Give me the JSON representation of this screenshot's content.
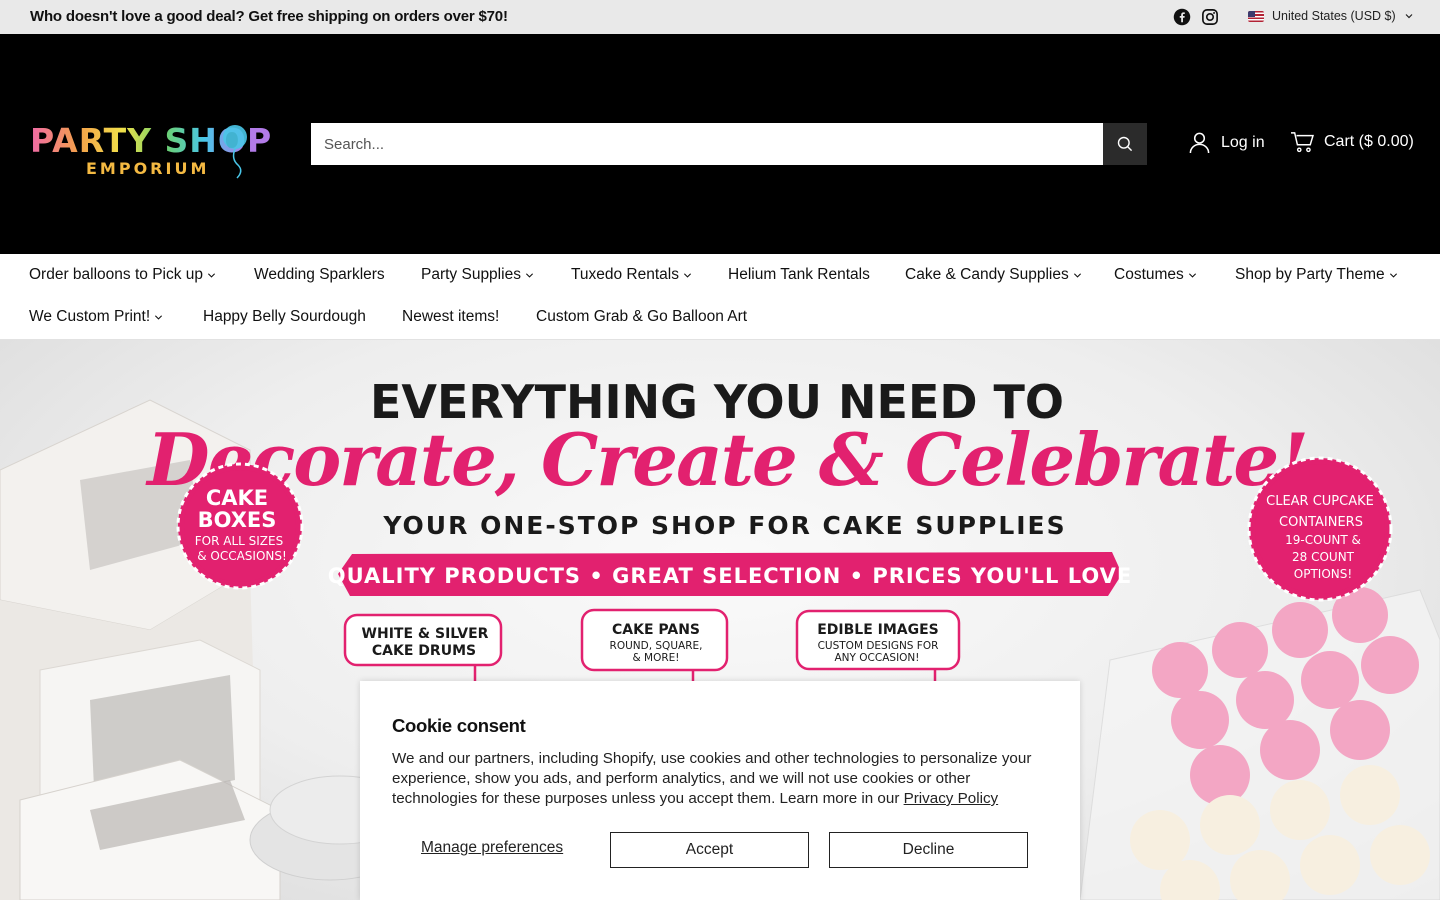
{
  "announcement": {
    "text": "Who doesn't love a good deal? Get free shipping on orders over $70!",
    "currency": "United States (USD $)"
  },
  "header": {
    "logo_top": "PARTY SHOP",
    "logo_bottom": "EMPORIUM",
    "search_placeholder": "Search...",
    "login_label": "Log in",
    "cart_label": "Cart ($ 0.00)"
  },
  "nav": {
    "row1": [
      {
        "label": "Order balloons to Pick up",
        "dropdown": true
      },
      {
        "label": "Wedding Sparklers",
        "dropdown": false
      },
      {
        "label": "Party Supplies",
        "dropdown": true
      },
      {
        "label": "Tuxedo Rentals",
        "dropdown": true
      },
      {
        "label": "Helium Tank Rentals",
        "dropdown": false
      },
      {
        "label": "Cake & Candy Supplies",
        "dropdown": true
      },
      {
        "label": "Costumes",
        "dropdown": true
      },
      {
        "label": "Shop by Party Theme",
        "dropdown": true
      }
    ],
    "row2": [
      {
        "label": "We Custom Print!",
        "dropdown": true
      },
      {
        "label": "Happy Belly Sourdough",
        "dropdown": false
      },
      {
        "label": "Newest items!",
        "dropdown": false
      },
      {
        "label": "Custom Grab & Go Balloon Art",
        "dropdown": false
      }
    ]
  },
  "hero": {
    "line1": "EVERYTHING YOU NEED TO",
    "line2": "Decorate, Create & Celebrate!",
    "line3": "YOUR ONE-STOP SHOP FOR CAKE SUPPLIES",
    "banner": "QUALITY PRODUCTS • GREAT SELECTION • PRICES YOU'LL LOVE",
    "badge_left": [
      "CAKE",
      "BOXES",
      "FOR ALL SIZES",
      "& OCCASIONS!"
    ],
    "badge_right": [
      "CLEAR CUPCAKE",
      "CONTAINERS",
      "19-COUNT &",
      "28 COUNT",
      "OPTIONS!"
    ],
    "tag1": [
      "WHITE & SILVER",
      "CAKE DRUMS"
    ],
    "tag2": [
      "CAKE PANS",
      "ROUND, SQUARE,",
      "& MORE!"
    ],
    "tag3": [
      "EDIBLE IMAGES",
      "CUSTOM DESIGNS FOR",
      "ANY OCCASION!"
    ]
  },
  "cookie": {
    "title": "Cookie consent",
    "body": "We and our partners, including Shopify, use cookies and other technologies to personalize your experience, show you ads, and perform analytics, and we will not use cookies or other technologies for these purposes unless you accept them. Learn more in our ",
    "link": "Privacy Policy",
    "manage_label": "Manage preferences",
    "accept_label": "Accept",
    "decline_label": "Decline"
  },
  "colors": {
    "accent_pink": "#e2216f",
    "header_bg": "#000000",
    "announce_bg": "#e9e9e9"
  }
}
